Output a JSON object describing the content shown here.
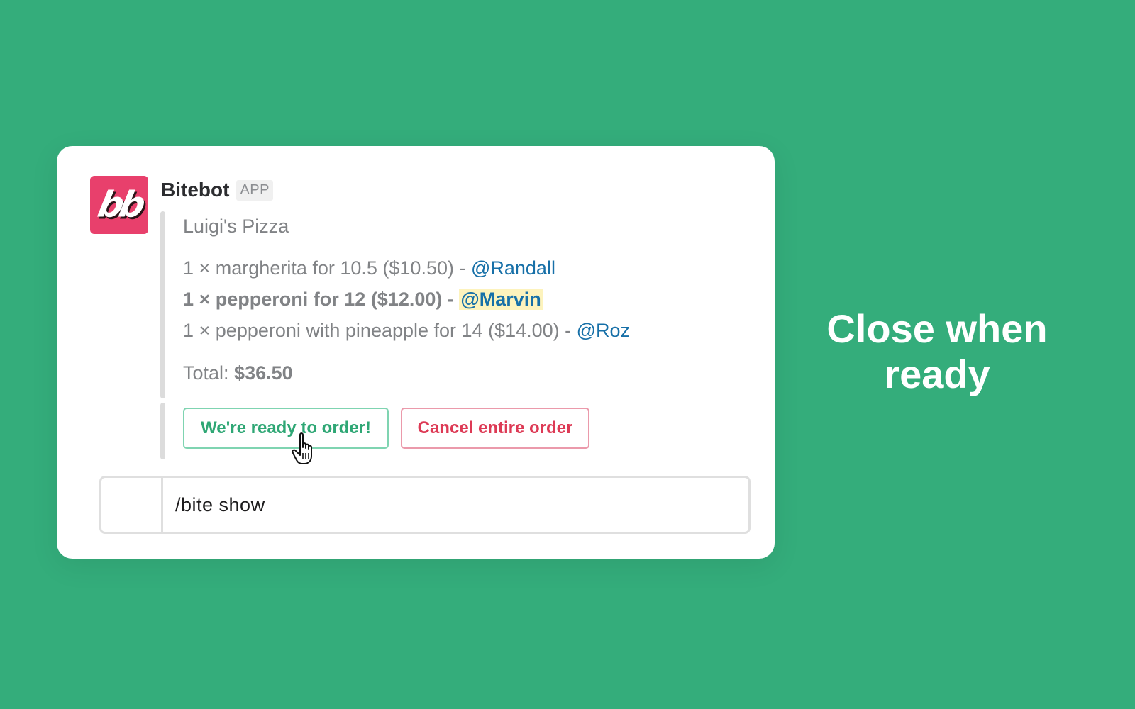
{
  "message": {
    "sender": {
      "name": "Bitebot",
      "badge": "APP",
      "avatar_icon": "bitebot-logo-icon",
      "avatar_text": "bb",
      "avatar_color": "#e8406c"
    },
    "attachment": {
      "restaurant": "Luigi's Pizza",
      "orders": [
        {
          "text": "1 × margherita for 10.5 ($10.50) - ",
          "mention": "@Randall"
        },
        {
          "text": "1 × pepperoni for 12 ($12.00) - ",
          "mention": "@Marvin"
        },
        {
          "text": "1 × pepperoni with pineapple for 14 ($14.00) - ",
          "mention": "@Roz"
        }
      ],
      "total_label": "Total: ",
      "total_value": "$36.50"
    },
    "actions": {
      "ready_label": "We're ready to order!",
      "cancel_label": "Cancel entire order"
    }
  },
  "composer": {
    "value": "/bite show"
  },
  "caption": {
    "line1": "Close when",
    "line2": "ready"
  },
  "colors": {
    "background": "#34ad7b",
    "mention": "#1770a8",
    "mention_highlight": "#fdf3bd",
    "ready_button": "#2fa775",
    "cancel_button": "#dd3a55"
  },
  "cursor_icon": "hand-pointer-icon"
}
